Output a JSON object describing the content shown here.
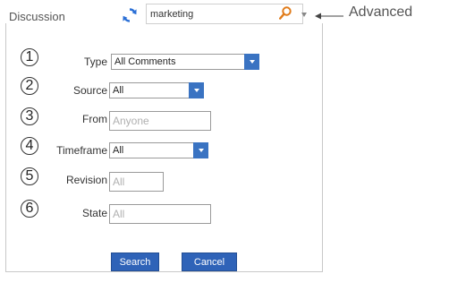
{
  "header": {
    "title": "Discussion",
    "search_value": "marketing",
    "advanced_label": "Advanced"
  },
  "form": {
    "rows": [
      {
        "number": "1",
        "label": "Type",
        "value": "All Comments"
      },
      {
        "number": "2",
        "label": "Source",
        "value": "All"
      },
      {
        "number": "3",
        "label": "From",
        "placeholder": "Anyone"
      },
      {
        "number": "4",
        "label": "Timeframe",
        "value": "All"
      },
      {
        "number": "5",
        "label": "Revision",
        "placeholder": "All"
      },
      {
        "number": "6",
        "label": "State",
        "placeholder": "All"
      }
    ],
    "search_label": "Search",
    "cancel_label": "Cancel"
  },
  "colors": {
    "accent": "#3a73c2",
    "button": "#2f63b8",
    "search_icon": "#e07b1a"
  },
  "icons": [
    "refresh-icon",
    "magnifier-icon",
    "dropdown-caret-icon",
    "arrow-left-icon"
  ]
}
